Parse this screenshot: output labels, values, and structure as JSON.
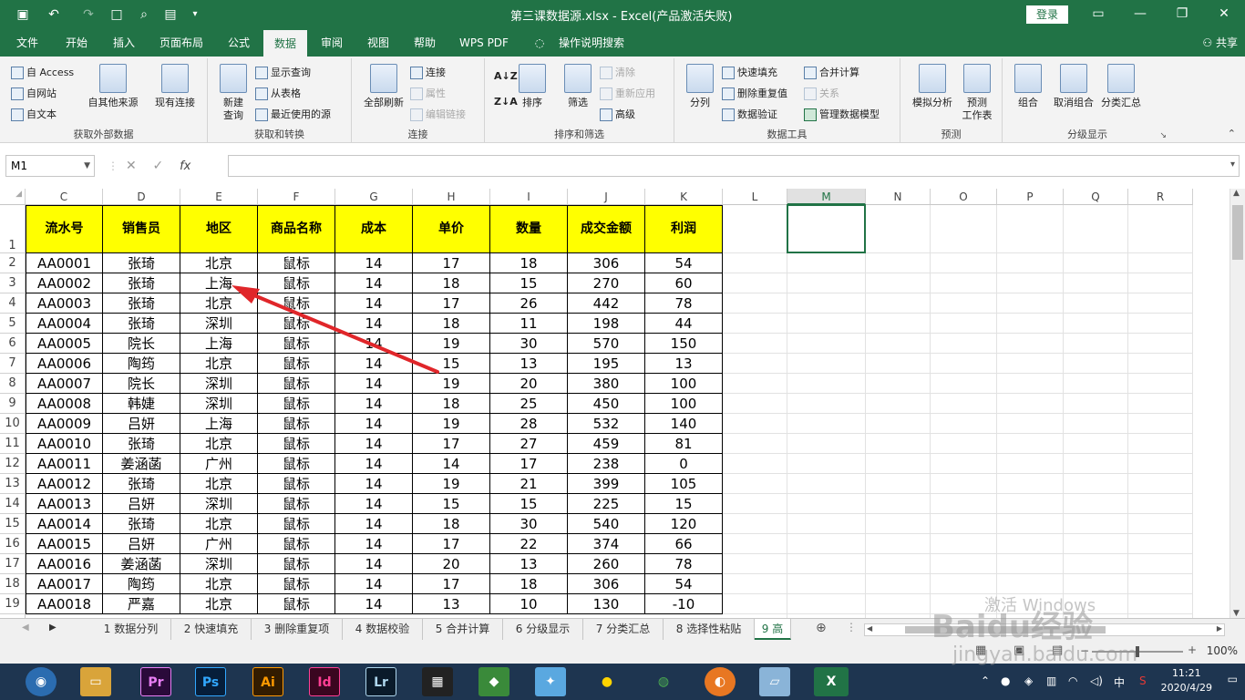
{
  "window": {
    "title": "第三课数据源.xlsx  -  Excel(产品激活失败)",
    "login": "登录"
  },
  "menu": {
    "tabs": [
      "文件",
      "开始",
      "插入",
      "页面布局",
      "公式",
      "数据",
      "审阅",
      "视图",
      "帮助",
      "WPS PDF",
      "操作说明搜索"
    ],
    "active": "数据",
    "share": "共享"
  },
  "ribbon": {
    "get_external": {
      "access": "自 Access",
      "web": "自网站",
      "text": "自文本",
      "other": "自其他来源",
      "existing": "现有连接",
      "label": "获取外部数据"
    },
    "transform": {
      "new_query": "新建\n查询",
      "show_query": "显示查询",
      "from_table": "从表格",
      "recent": "最近使用的源",
      "label": "获取和转换"
    },
    "connections": {
      "refresh": "全部刷新",
      "conn": "连接",
      "props": "属性",
      "edit": "编辑链接",
      "label": "连接"
    },
    "sort_filter": {
      "sort": "排序",
      "filter": "筛选",
      "clear": "清除",
      "reapply": "重新应用",
      "advanced": "高级",
      "label": "排序和筛选"
    },
    "data_tools": {
      "split": "分列",
      "flash": "快速填充",
      "remove_dup": "删除重复值",
      "validate": "数据验证",
      "consolidate": "合并计算",
      "relations": "关系",
      "model": "管理数据模型",
      "label": "数据工具"
    },
    "forecast": {
      "whatif": "模拟分析",
      "sheet": "预测\n工作表",
      "label": "预测"
    },
    "outline": {
      "group": "组合",
      "ungroup": "取消组合",
      "subtotal": "分类汇总",
      "label": "分级显示"
    }
  },
  "formula": {
    "namebox": "M1",
    "fx": "fx",
    "value": ""
  },
  "columns": [
    "C",
    "D",
    "E",
    "F",
    "G",
    "H",
    "I",
    "J",
    "K",
    "L",
    "M",
    "N",
    "O",
    "P",
    "Q",
    "R"
  ],
  "selected_column": "M",
  "headers": [
    "流水号",
    "销售员",
    "地区",
    "商品名称",
    "成本",
    "单价",
    "数量",
    "成交金额",
    "利润"
  ],
  "rows": [
    [
      "AA0001",
      "张琦",
      "北京",
      "鼠标",
      "14",
      "17",
      "18",
      "306",
      "54"
    ],
    [
      "AA0002",
      "张琦",
      "上海",
      "鼠标",
      "14",
      "18",
      "15",
      "270",
      "60"
    ],
    [
      "AA0003",
      "张琦",
      "北京",
      "鼠标",
      "14",
      "17",
      "26",
      "442",
      "78"
    ],
    [
      "AA0004",
      "张琦",
      "深圳",
      "鼠标",
      "14",
      "18",
      "11",
      "198",
      "44"
    ],
    [
      "AA0005",
      "院长",
      "上海",
      "鼠标",
      "14",
      "19",
      "30",
      "570",
      "150"
    ],
    [
      "AA0006",
      "陶筠",
      "北京",
      "鼠标",
      "14",
      "15",
      "13",
      "195",
      "13"
    ],
    [
      "AA0007",
      "院长",
      "深圳",
      "鼠标",
      "14",
      "19",
      "20",
      "380",
      "100"
    ],
    [
      "AA0008",
      "韩婕",
      "深圳",
      "鼠标",
      "14",
      "18",
      "25",
      "450",
      "100"
    ],
    [
      "AA0009",
      "吕妍",
      "上海",
      "鼠标",
      "14",
      "19",
      "28",
      "532",
      "140"
    ],
    [
      "AA0010",
      "张琦",
      "北京",
      "鼠标",
      "14",
      "17",
      "27",
      "459",
      "81"
    ],
    [
      "AA0011",
      "姜涵菡",
      "广州",
      "鼠标",
      "14",
      "14",
      "17",
      "238",
      "0"
    ],
    [
      "AA0012",
      "张琦",
      "北京",
      "鼠标",
      "14",
      "19",
      "21",
      "399",
      "105"
    ],
    [
      "AA0013",
      "吕妍",
      "深圳",
      "鼠标",
      "14",
      "15",
      "15",
      "225",
      "15"
    ],
    [
      "AA0014",
      "张琦",
      "北京",
      "鼠标",
      "14",
      "18",
      "30",
      "540",
      "120"
    ],
    [
      "AA0015",
      "吕妍",
      "广州",
      "鼠标",
      "14",
      "17",
      "22",
      "374",
      "66"
    ],
    [
      "AA0016",
      "姜涵菡",
      "深圳",
      "鼠标",
      "14",
      "20",
      "13",
      "260",
      "78"
    ],
    [
      "AA0017",
      "陶筠",
      "北京",
      "鼠标",
      "14",
      "17",
      "18",
      "306",
      "54"
    ],
    [
      "AA0018",
      "严嘉",
      "北京",
      "鼠标",
      "14",
      "13",
      "10",
      "130",
      "-10"
    ]
  ],
  "sheets": [
    "1 数据分列",
    "2 快速填充",
    "3 删除重复项",
    "4 数据校验",
    "5 合并计算",
    "6 分级显示",
    "7 分类汇总",
    "8 选择性粘贴",
    "9 高"
  ],
  "active_sheet": "9 高",
  "status": {
    "zoom": "100%"
  },
  "taskbar": {
    "apps": [
      "Pr",
      "Ps",
      "Ai",
      "Id",
      "Lr"
    ],
    "time": "11:21",
    "date": "2020/4/29",
    "ime": "中"
  },
  "watermark": {
    "brand": "Baidu经验",
    "url": "jingyan.baidu.com",
    "activate": "激活 Windows"
  },
  "colors": {
    "excel_green": "#217346",
    "header_fill": "#ffff00",
    "arrow": "#e0262a"
  }
}
